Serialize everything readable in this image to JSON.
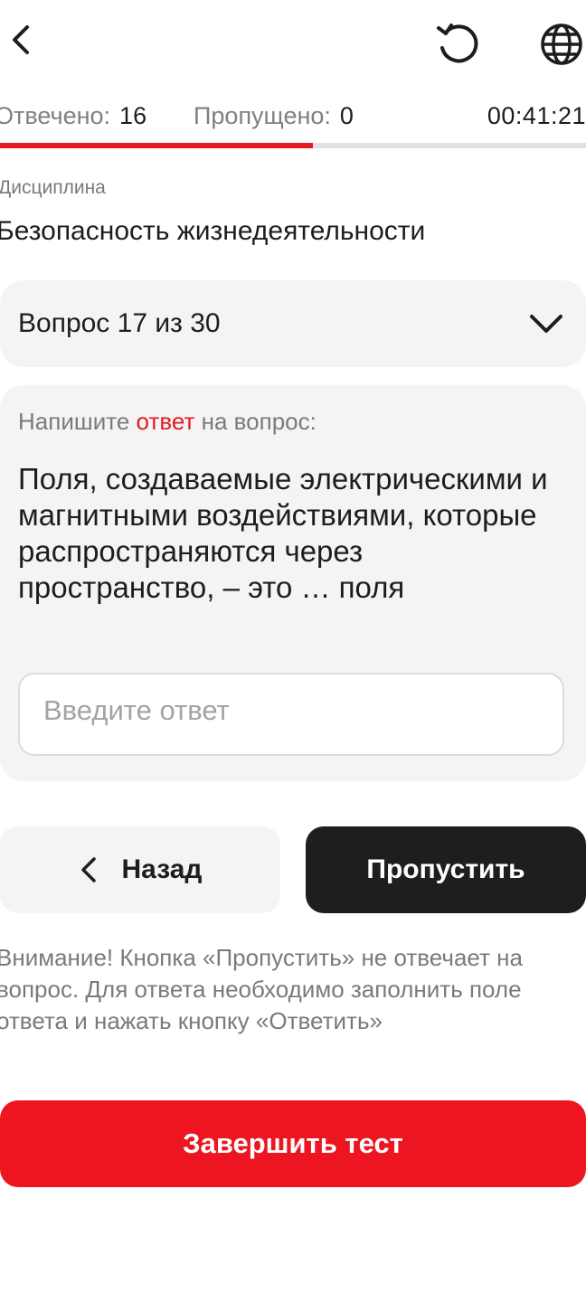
{
  "header": {
    "icons": [
      "back-icon",
      "reset-icon",
      "globe-icon"
    ]
  },
  "stats": {
    "answered_label": "Отвечено:",
    "answered_value": "16",
    "skipped_label": "Пропущено:",
    "skipped_value": "0",
    "timer": "00:41:21"
  },
  "progress": {
    "fraction": 0.5333,
    "fill_color": "#e31b23",
    "track_color": "#e2e2e6"
  },
  "discipline": {
    "label": "Дисциплина",
    "value": "Безопасность жизнедеятельности"
  },
  "question_selector": {
    "label": "Вопрос 17 из 30"
  },
  "question": {
    "instruction_prefix": "Напишите",
    "instruction_accent": "ответ",
    "instruction_suffix": "на вопрос:",
    "text": "Поля, создаваемые электрическими и магнитными воздействиями, которые распространяются через пространство, – это … поля",
    "answer_value": "",
    "answer_placeholder": "Введите ответ"
  },
  "buttons": {
    "back_label": "Назад",
    "skip_label": "Пропустить",
    "finish_label": "Завершить тест"
  },
  "warning": "Внимание! Кнопка «Пропустить» не отвечает на вопрос. Для ответа необходимо заполнить поле ответа и нажать кнопку «Ответить»",
  "colors": {
    "accent": "#e31b23",
    "finish_button": "#ec1520",
    "skip_button": "#1e1e1e",
    "card_background": "#f4f4f4"
  }
}
